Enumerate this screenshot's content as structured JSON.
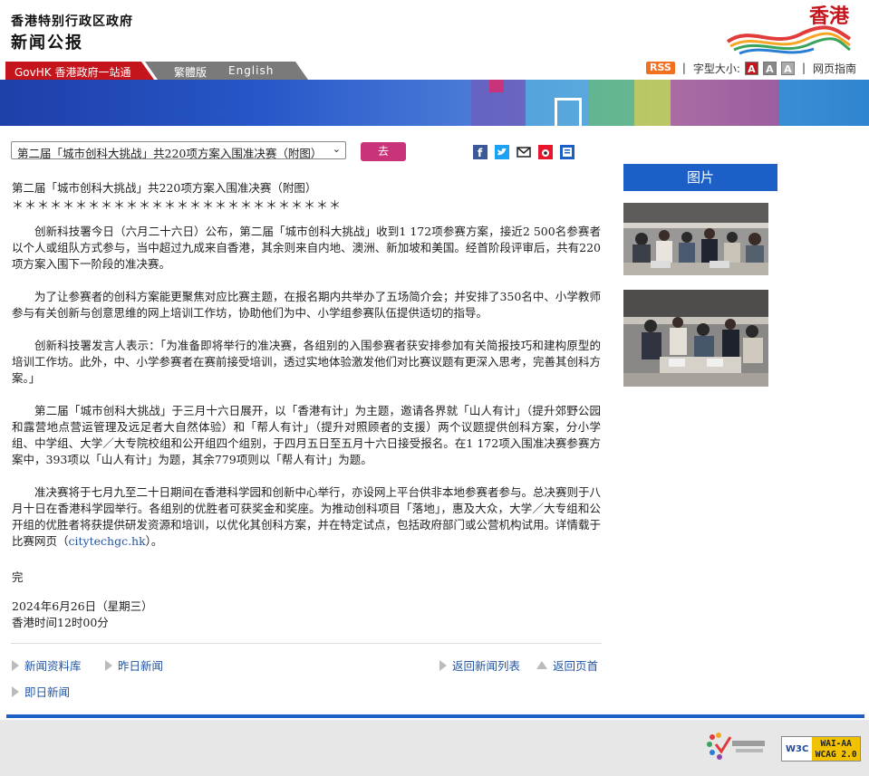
{
  "header": {
    "gov_name": "香港特别行政区政府",
    "site_title": "新闻公报",
    "brand_text": "香港"
  },
  "nav": {
    "govhk_label": "GovHK 香港政府一站通",
    "lang_traditional": "繁體版",
    "lang_english": "English",
    "rss_label": "RSS",
    "font_size_label": "字型大小:",
    "font_size_buttons": [
      "A",
      "A",
      "A"
    ],
    "guide_label": "网页指南"
  },
  "toolbar": {
    "select_value": "第二届「城市创科大挑战」共220项方案入围准决赛（附图）",
    "go_label": "去",
    "share_icons": [
      "facebook-icon",
      "twitter-icon",
      "email-icon",
      "weibo-icon",
      "print-icon"
    ]
  },
  "article": {
    "title": "第二届「城市创科大挑战」共220项方案入围准决赛（附图）",
    "stars": "＊＊＊＊＊＊＊＊＊＊＊＊＊＊＊＊＊＊＊＊＊＊＊＊＊＊",
    "p1": "创新科技署今日（六月二十六日）公布，第二届「城市创科大挑战」收到1 172项参赛方案，接近2 500名参赛者以个人或组队方式参与，当中超过九成来自香港，其余则来自内地、澳洲、新加坡和美国。经首阶段评审后，共有220项方案入围下一阶段的准决赛。",
    "p2": "为了让参赛者的创科方案能更聚焦对应比赛主题，在报名期内共举办了五场简介会；并安排了350名中、小学教师参与有关创新与创意思维的网上培训工作坊，协助他们为中、小学组参赛队伍提供适切的指导。",
    "p3": "创新科技署发言人表示：「为准备即将举行的准决赛，各组别的入围参赛者获安排参加有关简报技巧和建构原型的培训工作坊。此外，中、小学参赛者在赛前接受培训，透过实地体验激发他们对比赛议题有更深入思考，完善其创科方案。」",
    "p4": "第二届「城市创科大挑战」于三月十六日展开，以「香港有计」为主题，邀请各界就「山人有计」（提升郊野公园和露营地点营运管理及远足者大自然体验）和「帮人有计」（提升对照顾者的支援）两个议题提供创科方案，分小学组、中学组、大学／大专院校组和公开组四个组别，于四月五日至五月十六日接受报名。在1 172项入围准决赛参赛方案中，393项以「山人有计」为题，其余779项则以「帮人有计」为题。",
    "p5_before": "准决赛将于七月九至二十日期间在香港科学园和创新中心举行，亦设网上平台供非本地参赛者参与。总决赛则于八月十日在香港科学园举行。各组别的优胜者可获奖金和奖座。为推动创科项目「落地」，惠及大众，大学／大专组和公开组的优胜者将获提供研发资源和培训，以优化其创科方案，并在特定试点，包括政府部门或公营机构试用。详情载于比赛网页（",
    "p5_link": "citytechgc.hk",
    "p5_after": "）。",
    "end_mark": "完",
    "date": "2024年6月26日（星期三）",
    "time": "香港时间12时00分"
  },
  "footer_links": {
    "archive": "新闻资料库",
    "yesterday": "昨日新闻",
    "back_to_list": "返回新闻列表",
    "back_to_top": "返回页首",
    "instant": "即日新闻"
  },
  "sidebar": {
    "photo_header": "图片"
  },
  "footer": {
    "w3c": "W3C",
    "wcag_line1": "WAI-AA",
    "wcag_line2": "WCAG 2.0"
  },
  "colors": {
    "brand_red": "#c4151c",
    "accent_blue": "#1c5fc6",
    "go_button": "#c8337a",
    "link": "#2255a4"
  }
}
